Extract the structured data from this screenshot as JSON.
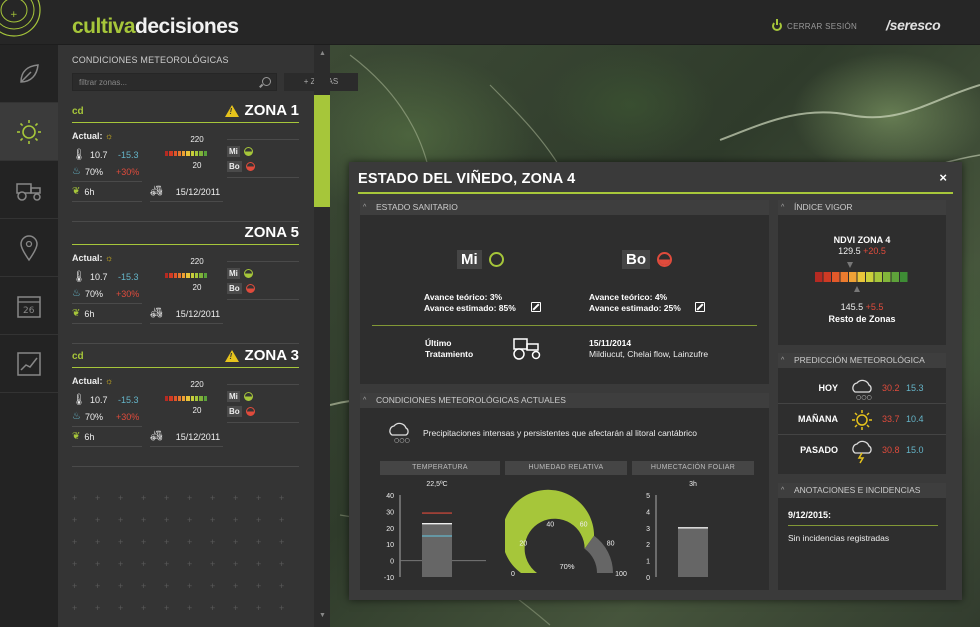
{
  "header": {
    "brand_part1": "cultiva",
    "brand_part2": "decisiones",
    "logout_label": "CERRAR SESIÓN",
    "partner_logo": "/seresco"
  },
  "rail": {
    "items": [
      {
        "icon": "leaf-icon",
        "active": false
      },
      {
        "icon": "sun-icon",
        "active": true
      },
      {
        "icon": "tractor-icon",
        "active": false
      },
      {
        "icon": "map-pin-icon",
        "active": false
      },
      {
        "icon": "calendar-icon",
        "active": false,
        "label": "26"
      },
      {
        "icon": "chart-icon",
        "active": false
      }
    ]
  },
  "panel": {
    "title": "CONDICIONES METEOROLÓGICAS",
    "filter_placeholder": "filtrar zonas...",
    "add_zones_label": "+ ZONAS",
    "zones": [
      {
        "badge": "cd",
        "name": "ZONA 1",
        "warning": true,
        "actual_label": "Actual:",
        "weather_icon": "sun-cloud-icon",
        "temp": "10.7",
        "temp_delta": "-15.3",
        "humidity": "70%",
        "humidity_delta": "+30%",
        "wet_hours": "6h",
        "gauge_top": "220",
        "gauge_bottom": "20",
        "mi": "Mi",
        "bo": "Bo",
        "last_date": "15/12/2011"
      },
      {
        "badge": "",
        "name": "ZONA 5",
        "warning": false,
        "actual_label": "Actual:",
        "weather_icon": "drop-icon",
        "temp": "10.7",
        "temp_delta": "-15.3",
        "humidity": "70%",
        "humidity_delta": "+30%",
        "wet_hours": "6h",
        "gauge_top": "220",
        "gauge_bottom": "20",
        "mi": "Mi",
        "bo": "Bo",
        "last_date": "15/12/2011"
      },
      {
        "badge": "cd",
        "name": "ZONA 3",
        "warning": true,
        "actual_label": "Actual:",
        "weather_icon": "cloud-sun-icon",
        "temp": "10.7",
        "temp_delta": "-15.3",
        "humidity": "70%",
        "humidity_delta": "+30%",
        "wet_hours": "6h",
        "gauge_top": "220",
        "gauge_bottom": "20",
        "mi": "Mi",
        "bo": "Bo",
        "last_date": "15/12/2011"
      }
    ]
  },
  "modal": {
    "title": "ESTADO DEL VIÑEDO, ZONA 4",
    "close": "×",
    "sanitario": {
      "heading": "ESTADO SANITARIO",
      "mi": {
        "label": "Mi",
        "status": "ok",
        "teorico": "Avance teórico: 3%",
        "estimado": "Avance estimado: 85%"
      },
      "bo": {
        "label": "Bo",
        "status": "alert",
        "teorico": "Avance teórico: 4%",
        "estimado": "Avance estimado: 25%"
      },
      "ultimo_label_1": "Último",
      "ultimo_label_2": "Tratamiento",
      "ultimo_date": "15/11/2014",
      "ultimo_products": "Mildiucut, Chelai flow, Lainzufre"
    },
    "condiciones": {
      "heading": "CONDICIONES METEOROLÓGICAS ACTUALES",
      "forecast_text": "Precipitaciones intensas y persistentes que afectarán al litoral cantábrico",
      "temperatura_label": "TEMPERATURA",
      "humedad_label": "HUMEDAD RELATIVA",
      "humectacion_label": "HUMECTACIÓN FOLIAR"
    },
    "vigor": {
      "heading": "ÍNDICE VIGOR",
      "zone_label": "NDVI ZONA 4",
      "zone_value": "129.5",
      "zone_delta": "+20.5",
      "rest_value": "145.5",
      "rest_delta": "+5.5",
      "rest_label": "Resto de Zonas"
    },
    "prediccion": {
      "heading": "PREDICCIÓN METEOROLÓGICA",
      "days": [
        {
          "day": "HOY",
          "icon": "rain-cloud-icon",
          "high": "30.2",
          "low": "15.3"
        },
        {
          "day": "MAÑANA",
          "icon": "sun-icon",
          "high": "33.7",
          "low": "10.4"
        },
        {
          "day": "PASADO",
          "icon": "storm-cloud-icon",
          "high": "30.8",
          "low": "15.0"
        }
      ]
    },
    "anotaciones": {
      "heading": "ANOTACIONES E INCIDENCIAS",
      "date": "9/12/2015:",
      "text": "Sin incidencias registradas"
    }
  },
  "chart_data": [
    {
      "type": "bar",
      "title": "TEMPERATURA",
      "data_label": "22,5ºC",
      "categories": [
        ""
      ],
      "values": [
        22.5
      ],
      "reference_lines": [
        {
          "value": 29,
          "color": "#e04b3c"
        },
        {
          "value": 15,
          "color": "#65b5c9"
        }
      ],
      "yticks": [
        40,
        30,
        20,
        10,
        0,
        -10
      ],
      "ylim": [
        -10,
        40
      ]
    },
    {
      "type": "gauge",
      "title": "HUMEDAD RELATIVA",
      "value": 70,
      "value_label": "70%",
      "ticks": [
        0,
        20,
        40,
        60,
        80,
        100
      ],
      "range": [
        0,
        100
      ]
    },
    {
      "type": "bar",
      "title": "HUMECTACIÓN FOLIAR",
      "data_label": "3h",
      "categories": [
        ""
      ],
      "values": [
        3
      ],
      "yticks": [
        5,
        4,
        3,
        2,
        1,
        0
      ],
      "ylim": [
        0,
        5
      ]
    }
  ],
  "colors": {
    "accent": "#a6c63a",
    "alert": "#e04b3c",
    "cold": "#65b5c9",
    "warning": "#e6c31c"
  }
}
